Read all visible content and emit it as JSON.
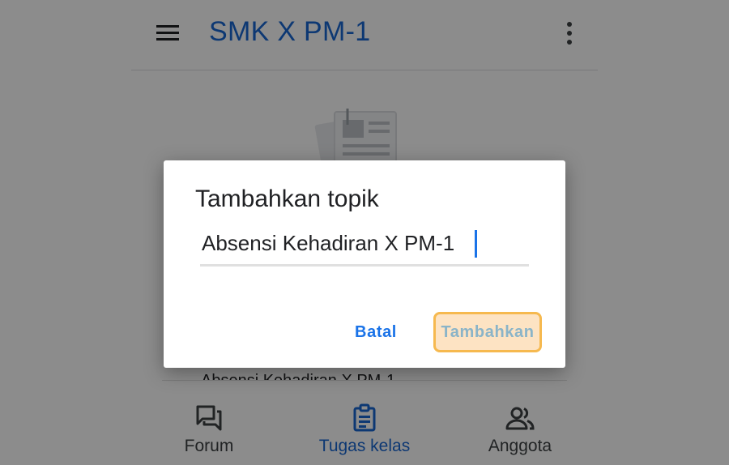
{
  "header": {
    "title": "SMK X PM-1",
    "menu_icon": "hamburger-menu-icon",
    "more_icon": "more-vert-icon"
  },
  "background": {
    "illustration_icon": "newspaper-illustration-icon",
    "hidden_row_text": "Absensi Kehadiran X PM-1"
  },
  "dialog": {
    "title": "Tambahkan topik",
    "topic_value": "Absensi Kehadiran X PM-1",
    "cancel_label": "Batal",
    "add_label": "Tambahkan"
  },
  "bottom_nav": {
    "items": [
      {
        "label": "Forum",
        "icon": "forum-icon",
        "active": false
      },
      {
        "label": "Tugas kelas",
        "icon": "classwork-icon",
        "active": true
      },
      {
        "label": "Anggota",
        "icon": "people-icon",
        "active": false
      }
    ]
  },
  "colors": {
    "accent": "#1967d2",
    "highlight_fill": "#fde3c3",
    "highlight_border": "#f6b94f"
  }
}
